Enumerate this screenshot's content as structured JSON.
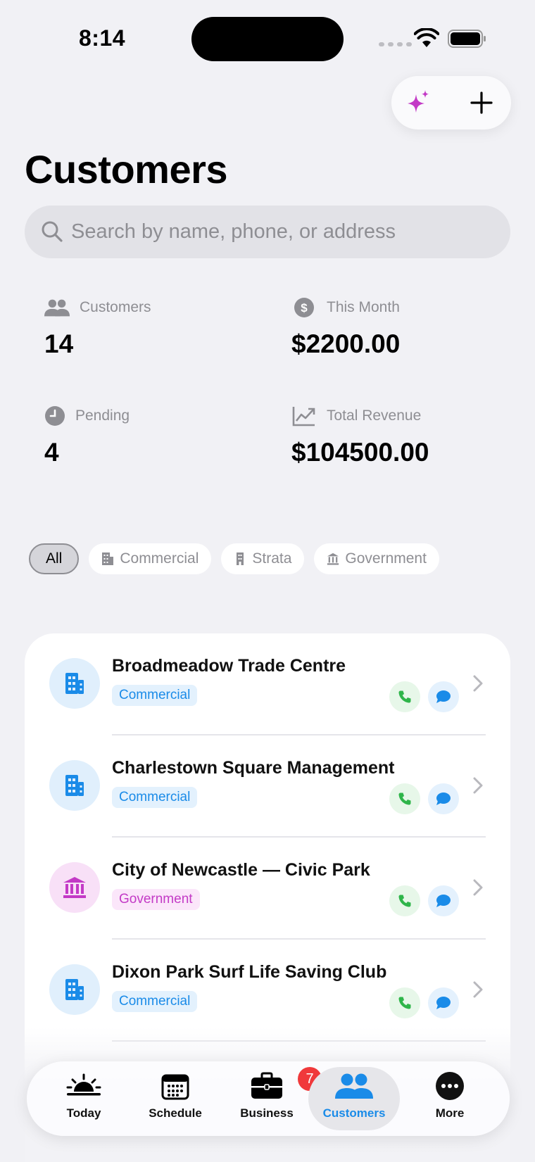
{
  "status_bar": {
    "time": "8:14"
  },
  "page": {
    "title": "Customers"
  },
  "search": {
    "placeholder": "Search by name, phone, or address"
  },
  "stats": [
    {
      "label": "Customers",
      "value": "14",
      "icon": "people-icon"
    },
    {
      "label": "This Month",
      "value": "$2200.00",
      "icon": "dollar-icon"
    },
    {
      "label": "Pending",
      "value": "4",
      "icon": "clock-icon"
    },
    {
      "label": "Total Revenue",
      "value": "$104500.00",
      "icon": "chart-up-icon"
    }
  ],
  "filters": [
    {
      "label": "All",
      "active": true
    },
    {
      "label": "Commercial",
      "icon": "building-icon"
    },
    {
      "label": "Strata",
      "icon": "tower-icon"
    },
    {
      "label": "Government",
      "icon": "bank-icon"
    }
  ],
  "customers": [
    {
      "name": "Broadmeadow Trade Centre",
      "type": "Commercial"
    },
    {
      "name": "Charlestown Square Management",
      "type": "Commercial"
    },
    {
      "name": "City of Newcastle — Civic Park",
      "type": "Government"
    },
    {
      "name": "Dixon Park Surf Life Saving Club",
      "type": "Commercial"
    }
  ],
  "tabs": [
    {
      "label": "Today",
      "icon": "sunrise-icon"
    },
    {
      "label": "Schedule",
      "icon": "calendar-icon"
    },
    {
      "label": "Business",
      "icon": "briefcase-icon",
      "badge": "7"
    },
    {
      "label": "Customers",
      "icon": "people-icon",
      "active": true
    },
    {
      "label": "More",
      "icon": "more-icon"
    }
  ],
  "colors": {
    "accent": "#1a8be8",
    "government": "#c33ac6",
    "call": "#2fb54a",
    "badge": "#f0393b",
    "sparkle": "#c33ac6"
  }
}
